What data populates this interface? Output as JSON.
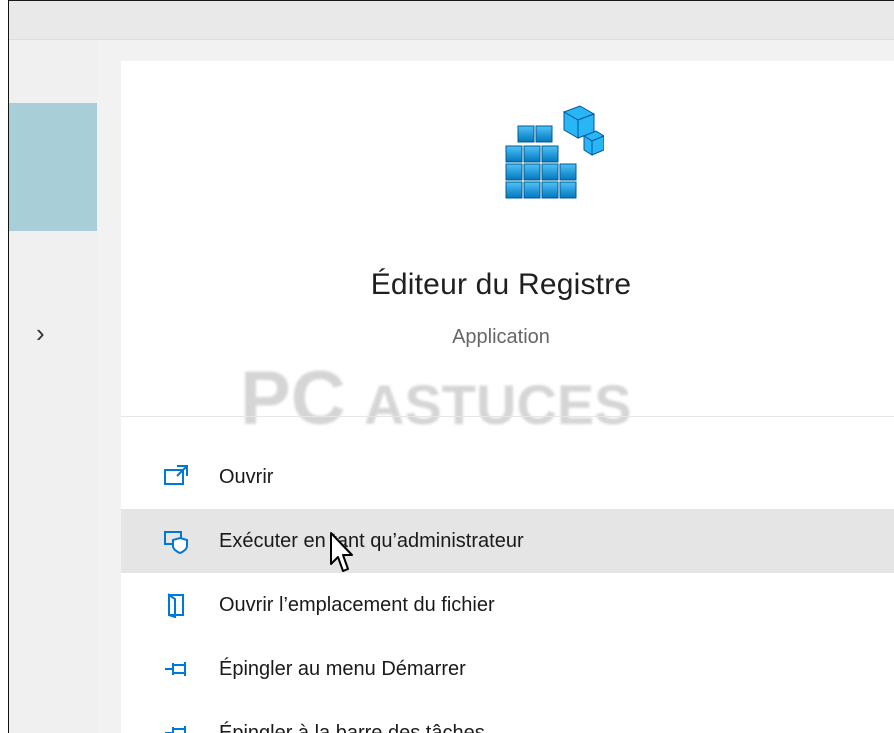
{
  "app": {
    "title": "Éditeur du Registre",
    "subtitle": "Application"
  },
  "watermark": {
    "text_pc": "PC",
    "text_astuces": "ASTUCES"
  },
  "menu": {
    "items": [
      {
        "label": "Ouvrir",
        "icon": "open-icon"
      },
      {
        "label": "Exécuter en tant qu’administrateur",
        "icon": "shield-admin-icon"
      },
      {
        "label": "Ouvrir l’emplacement du fichier",
        "icon": "file-location-icon"
      },
      {
        "label": "Épingler au menu Démarrer",
        "icon": "pin-start-icon"
      },
      {
        "label": "Épingler à la barre des tâches",
        "icon": "pin-taskbar-icon"
      }
    ]
  },
  "colors": {
    "accent": "#0078d7",
    "sidebar_highlight": "#a8cfd8",
    "hover_row": "#e5e5e5"
  }
}
